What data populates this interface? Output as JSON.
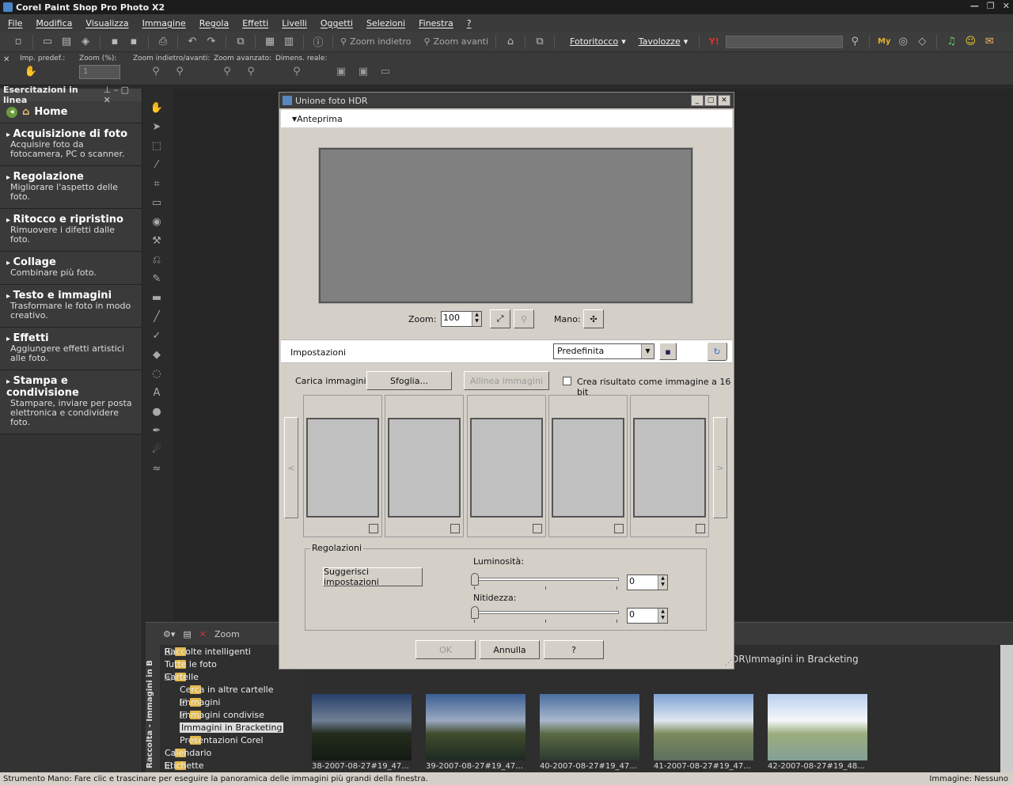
{
  "app": {
    "title": "Corel Paint Shop Pro Photo X2"
  },
  "menu": [
    "File",
    "Modifica",
    "Visualizza",
    "Immagine",
    "Regola",
    "Effetti",
    "Livelli",
    "Oggetti",
    "Selezioni",
    "Finestra",
    "?"
  ],
  "toolbar": {
    "zoom_out": "Zoom indietro",
    "zoom_in": "Zoom avanti",
    "fotoritocco": "Fotoritocco",
    "tavolozze": "Tavolozze"
  },
  "options": {
    "imp_predef": "Imp. predef.:",
    "zoom_pct": "Zoom (%):",
    "zoom_inout": "Zoom indietro/avanti:",
    "zoom_adv": "Zoom avanzato:",
    "dimens": "Dimens. reale:",
    "zoom_value": "1"
  },
  "learning": {
    "header": "Esercitazioni in linea",
    "home": "Home",
    "items": [
      {
        "title": "Acquisizione di foto",
        "desc": "Acquisire foto da fotocamera, PC o scanner."
      },
      {
        "title": "Regolazione",
        "desc": "Migliorare l'aspetto delle foto."
      },
      {
        "title": "Ritocco e ripristino",
        "desc": "Rimuovere i difetti dalle foto."
      },
      {
        "title": "Collage",
        "desc": "Combinare più foto."
      },
      {
        "title": "Testo e immagini",
        "desc": "Trasformare le foto in modo creativo."
      },
      {
        "title": "Effetti",
        "desc": "Aggiungere effetti artistici alle foto."
      },
      {
        "title": "Stampa e condivisione",
        "desc": "Stampare, inviare per posta elettronica e condividere foto."
      }
    ]
  },
  "organizer": {
    "vertical_label": "Raccolta - Immagini in B",
    "zoom_label": "Zoom",
    "path": "DR\\Immagini in Bracketing",
    "tree": [
      {
        "label": "Raccolte intelligenti",
        "plus": true,
        "indent": 0
      },
      {
        "label": "Tutte le foto",
        "plus": false,
        "indent": 0
      },
      {
        "label": "Cartelle",
        "plus": true,
        "indent": 0
      },
      {
        "label": "Cerca in altre cartelle",
        "plus": false,
        "indent": 1
      },
      {
        "label": "Immagini",
        "plus": true,
        "indent": 1
      },
      {
        "label": "Immagini condivise",
        "plus": true,
        "indent": 1
      },
      {
        "label": "Immagini in Bracketing",
        "plus": false,
        "indent": 1,
        "selected": true
      },
      {
        "label": "Presentazioni Corel",
        "plus": false,
        "indent": 1
      },
      {
        "label": "Calendario",
        "plus": false,
        "indent": 0
      },
      {
        "label": "Etichette",
        "plus": true,
        "indent": 0
      }
    ],
    "thumbs": [
      {
        "caption": "38-2007-08-27#19_47...",
        "tone": "dark"
      },
      {
        "caption": "39-2007-08-27#19_47...",
        "tone": "mid"
      },
      {
        "caption": "40-2007-08-27#19_47...",
        "tone": ""
      },
      {
        "caption": "41-2007-08-27#19_47...",
        "tone": "light"
      },
      {
        "caption": "42-2007-08-27#19_48...",
        "tone": "vlight"
      }
    ]
  },
  "dialog": {
    "title": "Unione foto HDR",
    "preview_label": "Anteprima",
    "zoom_label": "Zoom:",
    "zoom_value": "100",
    "hand_label": "Mano:",
    "settings_label": "Impostazioni",
    "preset": "Predefinita",
    "load_label": "Carica immagini:",
    "browse": "Sfoglia...",
    "align": "Allinea immagini",
    "bit16": "Crea risultato come immagine a 16 bit",
    "adjust_group": "Regolazioni",
    "suggest": "Suggerisci impostazioni",
    "brightness_label": "Luminosità:",
    "brightness_value": "0",
    "sharpness_label": "Nitidezza:",
    "sharpness_value": "0",
    "ok": "OK",
    "cancel": "Annulla",
    "help": "?",
    "prev_arrow": "<",
    "next_arrow": ">"
  },
  "status": {
    "left": "Strumento Mano: Fare clic e trascinare per eseguire la panoramica delle immagini più grandi della finestra.",
    "right": "Immagine: Nessuno"
  }
}
